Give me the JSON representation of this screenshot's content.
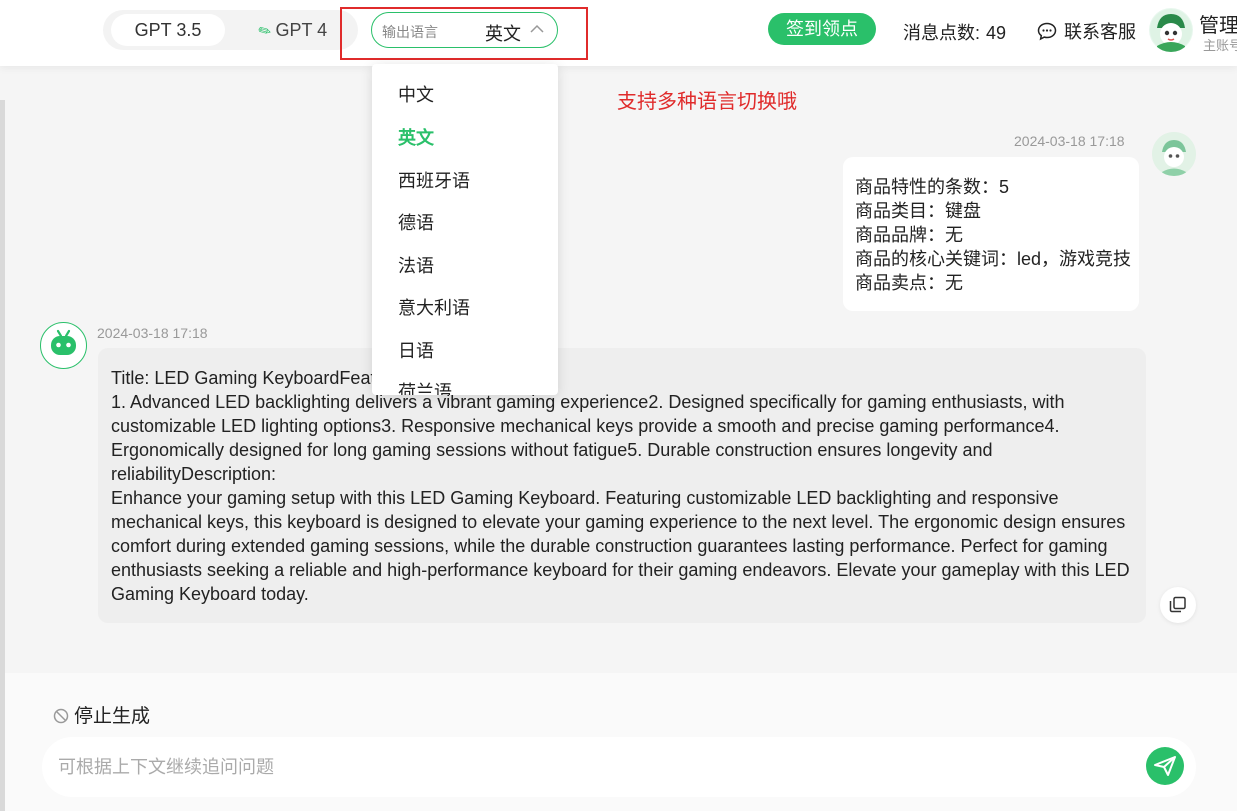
{
  "header": {
    "models": [
      {
        "label": "GPT 3.5",
        "active": true
      },
      {
        "label": "GPT 4",
        "active": false
      }
    ],
    "language": {
      "label": "输出语言",
      "value": "英文"
    },
    "checkin_label": "签到领点",
    "points_label": "消息点数:",
    "points_value": "49",
    "support_label": "联系客服",
    "user_name": "管理",
    "user_sub": "主账号"
  },
  "annotation": "支持多种语言切换哦",
  "dropdown": {
    "items": [
      "中文",
      "英文",
      "西班牙语",
      "德语",
      "法语",
      "意大利语",
      "日语",
      "荷兰语"
    ],
    "active_index": 1
  },
  "messages": {
    "user": {
      "timestamp": "2024-03-18 17:18",
      "lines": [
        "商品特性的条数：5",
        "商品类目：键盘",
        "商品品牌：无",
        "商品的核心关键词：led，游戏竞技",
        "商品卖点：无"
      ]
    },
    "bot": {
      "timestamp": "2024-03-18 17:18",
      "paragraphs": [
        "Title: LED Gaming KeyboardFeatures:",
        "1. Advanced LED backlighting delivers a vibrant gaming experience2. Designed specifically for gaming enthusiasts, with customizable LED lighting options3. Responsive mechanical keys provide a smooth and precise gaming performance4. Ergonomically designed for long gaming sessions without fatigue5. Durable construction ensures longevity and reliabilityDescription:",
        "Enhance your gaming setup with this LED Gaming Keyboard. Featuring customizable LED backlighting and responsive mechanical keys, this keyboard is designed to elevate your gaming experience to the next level. The ergonomic design ensures comfort during extended gaming sessions, while the durable construction guarantees lasting performance. Perfect for gaming enthusiasts seeking a reliable and high-performance keyboard for their gaming endeavors. Elevate your gameplay with this LED Gaming Keyboard today."
      ]
    }
  },
  "composer": {
    "stop_label": "停止生成",
    "placeholder": "可根据上下文继续追问问题"
  },
  "icons": {
    "gpt4": "magic-wand-icon",
    "chevron": "chevron-up-icon",
    "support": "chat-bubble-icon",
    "copy": "copy-icon",
    "stop": "ban-icon",
    "send": "send-icon"
  },
  "colors": {
    "accent": "#2ac06a",
    "annotation": "#e02b2b"
  }
}
